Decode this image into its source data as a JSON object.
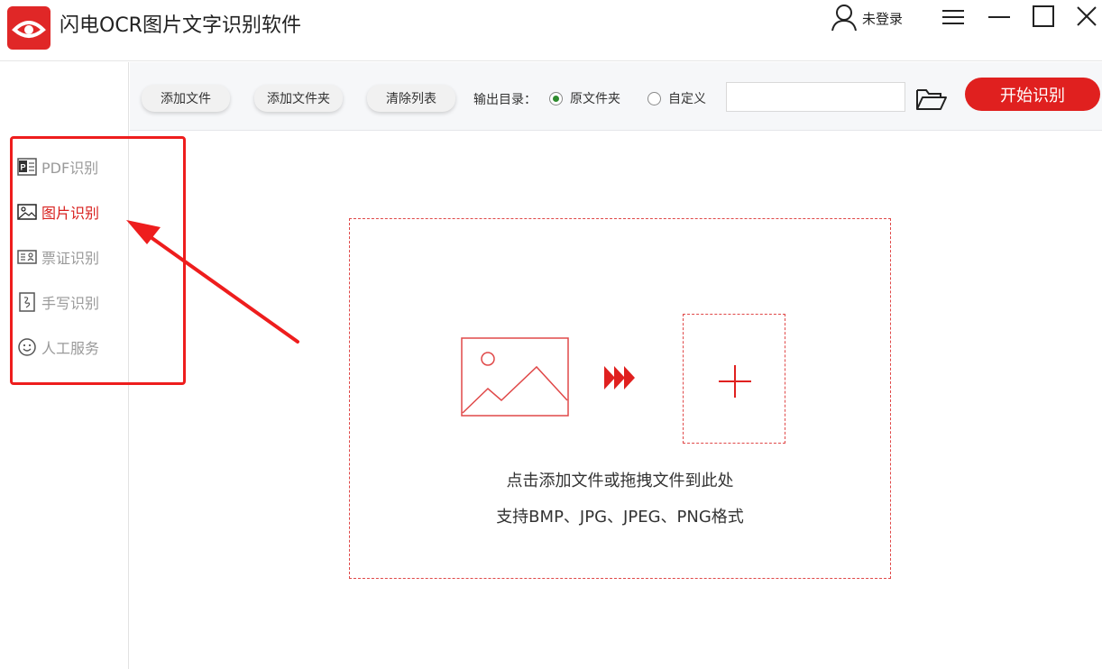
{
  "app": {
    "title": "闪电OCR图片文字识别软件",
    "user_label": "未登录"
  },
  "colors": {
    "brand": "#e0201f",
    "inactive_text": "#9a9a9a",
    "toolbar_bg": "#f6f7f9",
    "radio_checked": "#2e8b2e"
  },
  "window_controls": [
    "menu-icon",
    "minimize-icon",
    "maximize-icon",
    "close-icon"
  ],
  "sidebar": {
    "items": [
      {
        "label": "PDF识别",
        "icon": "pdf-icon",
        "active": false
      },
      {
        "label": "图片识别",
        "icon": "image-icon",
        "active": true
      },
      {
        "label": "票证识别",
        "icon": "id-card-icon",
        "active": false
      },
      {
        "label": "手写识别",
        "icon": "handwriting-icon",
        "active": false
      },
      {
        "label": "人工服务",
        "icon": "smiley-icon",
        "active": false
      }
    ]
  },
  "toolbar": {
    "add_file": "添加文件",
    "add_folder": "添加文件夹",
    "clear_list": "清除列表",
    "output_label": "输出目录：",
    "output_options": [
      {
        "label": "原文件夹",
        "checked": true
      },
      {
        "label": "自定义",
        "checked": false
      }
    ],
    "output_path": "",
    "start_label": "开始识别"
  },
  "dropzone": {
    "line1": "点击添加文件或拖拽文件到此处",
    "line2": "支持BMP、JPG、JPEG、PNG格式"
  }
}
